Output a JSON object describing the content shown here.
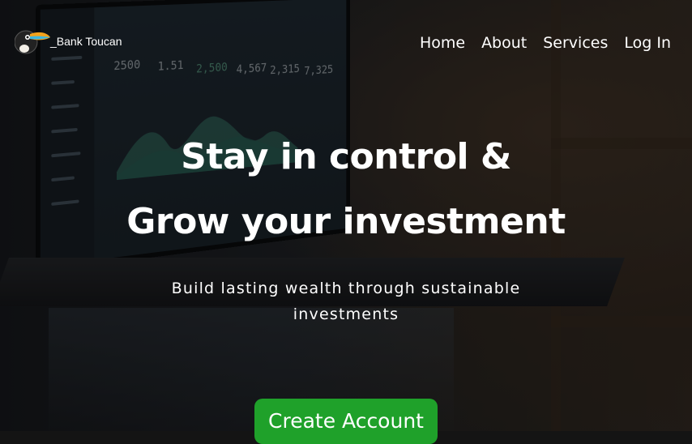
{
  "brand": {
    "name": "_Bank Toucan",
    "logo_icon": "toucan-logo-icon"
  },
  "nav": {
    "links": [
      "Home",
      "About",
      "Services",
      "Log In"
    ]
  },
  "hero": {
    "headline_line1": "Stay in control &",
    "headline_line2": "Grow your investment",
    "subheadline": "Build lasting wealth through sustainable investments",
    "cta_label": "Create Account"
  },
  "background": {
    "dashboard_numbers": [
      "2500",
      "1.51",
      "2,500",
      "4,567",
      "2,315",
      "7,325"
    ]
  },
  "colors": {
    "cta": "#1fa12a",
    "text": "#ffffff"
  }
}
